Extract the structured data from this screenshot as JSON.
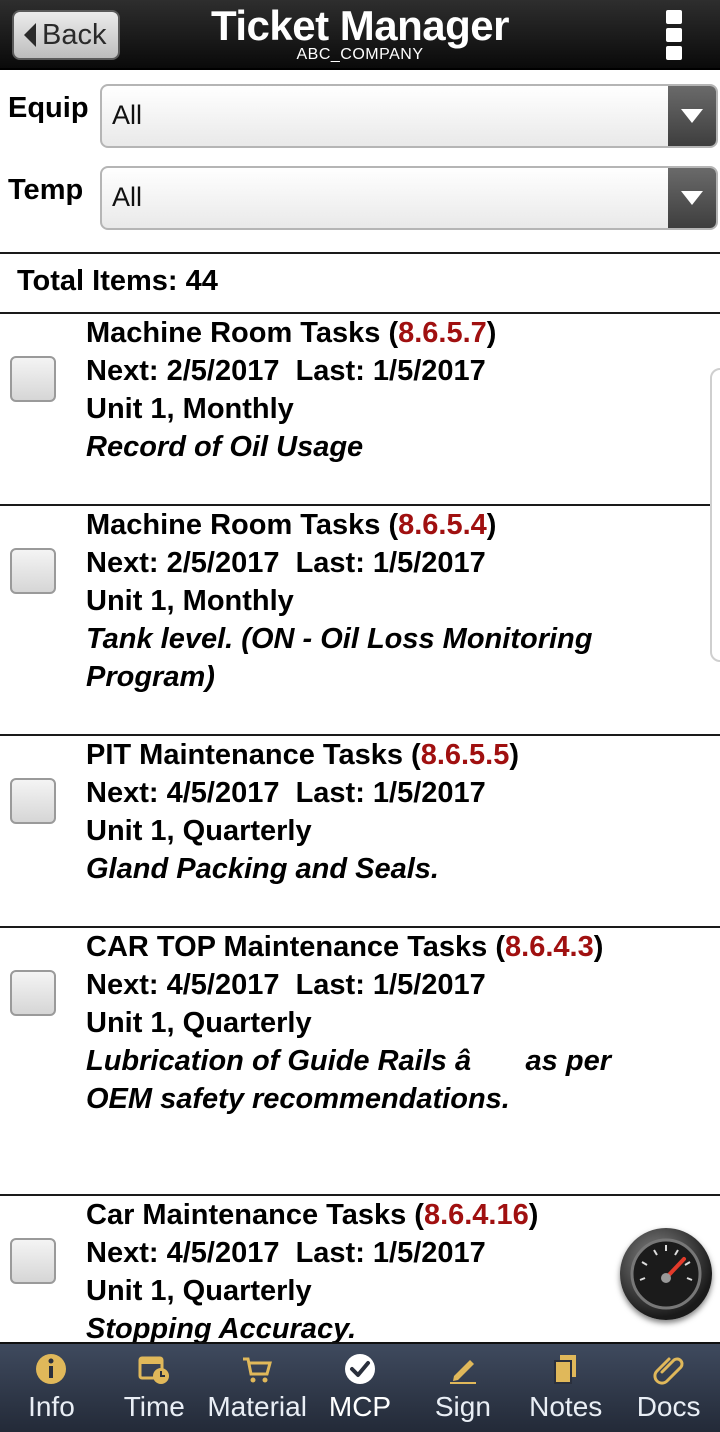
{
  "header": {
    "back_label": "Back",
    "title": "Ticket Manager",
    "subtitle": "ABC_COMPANY"
  },
  "filters": {
    "equip": {
      "label": "Equip",
      "value": "All"
    },
    "temp": {
      "label": "Temp",
      "value": "All"
    }
  },
  "total_items": "Total Items: 44",
  "items": [
    {
      "title": "Machine Room Tasks",
      "code": "8.6.5.7",
      "schedule": "Next: 2/5/2017  Last: 1/5/2017",
      "unit": "Unit 1, Monthly",
      "desc": "Record of Oil Usage"
    },
    {
      "title": "Machine Room Tasks",
      "code": "8.6.5.4",
      "schedule": "Next: 2/5/2017  Last: 1/5/2017",
      "unit": "Unit 1, Monthly",
      "desc": "Tank level. (ON - Oil Loss Monitoring Program)"
    },
    {
      "title": "PIT Maintenance Tasks",
      "code": "8.6.5.5",
      "schedule": "Next: 4/5/2017  Last: 1/5/2017",
      "unit": "Unit 1, Quarterly",
      "desc": "Gland Packing and Seals."
    },
    {
      "title": "CAR TOP Maintenance Tasks",
      "code": "8.6.4.3",
      "schedule": "Next: 4/5/2017  Last: 1/5/2017",
      "unit": "Unit 1, Quarterly",
      "desc": "Lubrication of Guide Rails â as per OEM safety recommendations."
    },
    {
      "title": "Car Maintenance Tasks",
      "code": "8.6.4.16",
      "schedule": "Next: 4/5/2017  Last: 1/5/2017",
      "unit": "Unit 1, Quarterly",
      "desc": "Stopping Accuracy."
    }
  ],
  "tabs": [
    {
      "label": "Info",
      "icon": "info-icon"
    },
    {
      "label": "Time",
      "icon": "calendar-clock-icon"
    },
    {
      "label": "Material",
      "icon": "cart-icon"
    },
    {
      "label": "MCP",
      "icon": "check-circle-icon",
      "active": true
    },
    {
      "label": "Sign",
      "icon": "pen-icon"
    },
    {
      "label": "Notes",
      "icon": "notes-icon"
    },
    {
      "label": "Docs",
      "icon": "paperclip-icon"
    }
  ],
  "colors": {
    "code": "#a01010",
    "tab_icon": "#e0b85a"
  }
}
